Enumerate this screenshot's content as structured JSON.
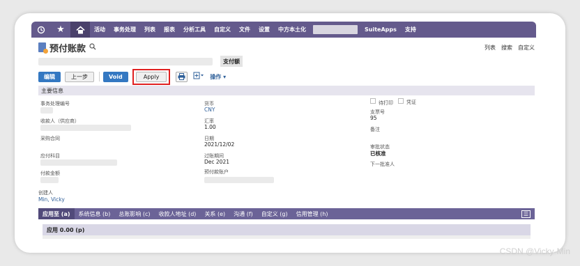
{
  "colors": {
    "nav_bg": "#645a8c",
    "primary_button": "#3478c2",
    "highlight": "#e02020",
    "subtab_bg": "#6b6397"
  },
  "nav": {
    "icons": [
      "clock-icon",
      "star-icon",
      "home-icon"
    ],
    "items": [
      "活动",
      "事务处理",
      "列表",
      "报表",
      "分析工具",
      "自定义",
      "文件",
      "设置",
      "中方本土化"
    ],
    "items_after": [
      "SuiteApps",
      "支持"
    ]
  },
  "page": {
    "title": "预付账款",
    "top_links": [
      "列表",
      "搜索",
      "自定义"
    ],
    "amount_label": "支付额"
  },
  "toolbar": {
    "edit": "编辑",
    "prev": "上一步",
    "void": "Void",
    "apply": "Apply",
    "actions": "操作"
  },
  "section": {
    "main_info": "主要信息"
  },
  "fields": {
    "txn_no_label": "事务处理编号",
    "payee_label": "收款人（供应商）",
    "contract_label": "采购合同",
    "account_label": "应付科目",
    "amount_label": "付款金额",
    "creator_label": "创建人",
    "creator_value": "Min, Vicky",
    "currency_label": "货币",
    "currency_value": "CNY",
    "rate_label": "汇率",
    "rate_value": "1.00",
    "date_label": "日期",
    "date_value": "2021/12/02",
    "period_label": "过账期间",
    "period_value": "Dec 2021",
    "prepay_account_label": "预付款账户",
    "to_print_label": "待打印",
    "voucher_label": "凭证",
    "check_no_label": "支票号",
    "check_no_value": "95",
    "memo_label": "备注",
    "approval_label": "审批状态",
    "approval_value": "已核准",
    "next_approver_label": "下一批准人"
  },
  "subtabs": [
    "应用至 (a)",
    "系统信息 (b)",
    "总账影响 (c)",
    "收款人地址 (d)",
    "关系 (e)",
    "沟通 (f)",
    "自定义 (g)",
    "信用管理 (h)"
  ],
  "applied": {
    "header": "应用 0.00 (p)"
  },
  "watermark": "CSDN @Vicky-Min"
}
